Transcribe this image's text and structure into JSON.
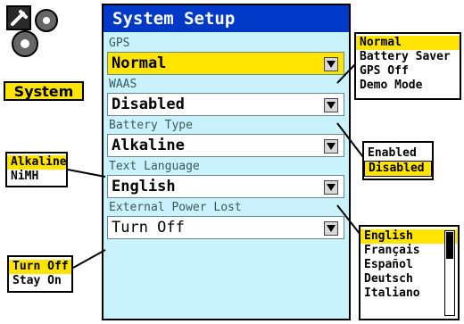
{
  "app": {
    "label": "System",
    "icon": "wrench-gears-icon"
  },
  "screen": {
    "title": "System Setup",
    "fields": [
      {
        "label": "GPS",
        "value": "Normal",
        "selected": true
      },
      {
        "label": "WAAS",
        "value": "Disabled",
        "selected": false
      },
      {
        "label": "Battery Type",
        "value": "Alkaline",
        "selected": false
      },
      {
        "label": "Text Language",
        "value": "English",
        "selected": false
      },
      {
        "label": "External Power Lost",
        "value": "Turn Off",
        "selected": false
      }
    ]
  },
  "popups": {
    "gps": {
      "options": [
        "Normal",
        "Battery Saver",
        "GPS Off",
        "Demo Mode"
      ],
      "highlighted": "Normal"
    },
    "waas": {
      "options": [
        "Enabled",
        "Disabled"
      ],
      "highlighted": "Disabled"
    },
    "battery": {
      "options": [
        "Alkaline",
        "NiMH"
      ],
      "highlighted": "Alkaline"
    },
    "language": {
      "options": [
        "English",
        "Français",
        "Español",
        "Deutsch",
        "Italiano"
      ],
      "highlighted": "English"
    },
    "power": {
      "options": [
        "Turn Off",
        "Stay On"
      ],
      "highlighted": "Turn Off"
    }
  },
  "colors": {
    "title_bar": "#0039c8",
    "body": "#c9f2fc",
    "highlight": "#ffe400",
    "frame": "#00a8e8"
  }
}
